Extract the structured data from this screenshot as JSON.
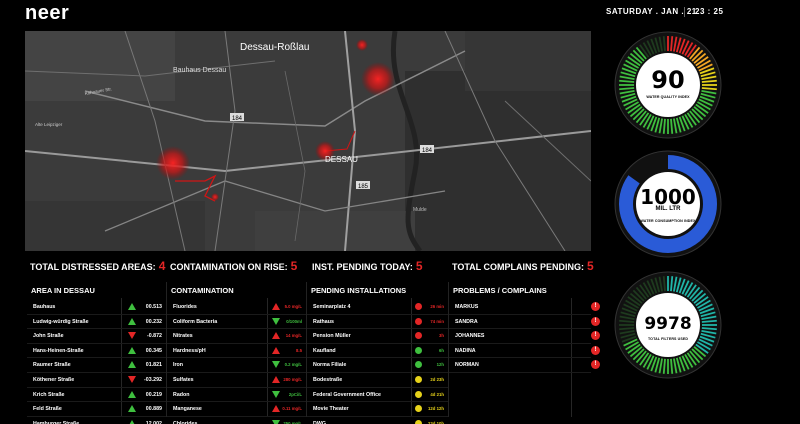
{
  "header": {
    "logo": "neer",
    "date": "SATURDAY . JAN . 21",
    "time": "23 : 25"
  },
  "map": {
    "labels": [
      "Dessau-Roßlau",
      "Bauhaus Dessau",
      "DESSAU",
      "184",
      "185",
      "184",
      "Kühnauer Str.",
      "Alte Leipziger",
      "Mulde"
    ]
  },
  "gauges": [
    {
      "value": "90",
      "unit": "",
      "label": "WATER QUALITY INDEX",
      "level": 0.9
    },
    {
      "value": "1000",
      "unit": "MIL. LTR",
      "label": "WATER CONSUMPTION INDEX",
      "level": 0.85
    },
    {
      "value": "9978",
      "unit": "",
      "label": "TOTAL FILTERS USED",
      "level": 0.7
    }
  ],
  "stats": [
    {
      "label": "TOTAL DISTRESSED AREAS:",
      "value": "4"
    },
    {
      "label": "CONTAMINATION ON RISE:",
      "value": "5"
    },
    {
      "label": "INST. PENDING TODAY:",
      "value": "5"
    },
    {
      "label": "TOTAL COMPLAINS PENDING:",
      "value": "5"
    }
  ],
  "areas": {
    "title": "AREA IN DESSAU",
    "rows": [
      {
        "name": "Bauhaus",
        "trend": "up",
        "value": "00.513"
      },
      {
        "name": "Ludwig-würdig Straße",
        "trend": "up",
        "value": "00.232"
      },
      {
        "name": "John Straße",
        "trend": "down",
        "value": "-0.872"
      },
      {
        "name": "Hans-Heinen-Straße",
        "trend": "up",
        "value": "00.345"
      },
      {
        "name": "Raumer Straße",
        "trend": "up",
        "value": "01.821"
      },
      {
        "name": "Köthener Straße",
        "trend": "down",
        "value": "-03.292"
      },
      {
        "name": "Krich Straße",
        "trend": "up",
        "value": "00.219"
      },
      {
        "name": "Feld Straße",
        "trend": "up",
        "value": "00.889"
      },
      {
        "name": "Hamburger Straße",
        "trend": "up",
        "value": "12.002"
      }
    ]
  },
  "contamination": {
    "title": "CONTAMINATION",
    "rows": [
      {
        "name": "Fluorides",
        "trend": "up-red",
        "value": "5.0 mg/L"
      },
      {
        "name": "Coliform Bacteria",
        "trend": "down-green",
        "value": "0/100ml"
      },
      {
        "name": "Nitrates",
        "trend": "up-red",
        "value": "14 mg/L"
      },
      {
        "name": "Hardness/pH",
        "trend": "up-red",
        "value": "8.5"
      },
      {
        "name": "Iron",
        "trend": "down-green",
        "value": "0.2 mg/L"
      },
      {
        "name": "Sulfates",
        "trend": "up-red",
        "value": "280 mg/L"
      },
      {
        "name": "Radon",
        "trend": "down-green",
        "value": "2pCi/L"
      },
      {
        "name": "Manganese",
        "trend": "up-red",
        "value": "0.11 mg/L"
      },
      {
        "name": "Chlorides",
        "trend": "down-green",
        "value": "250 mg/L"
      }
    ]
  },
  "installations": {
    "title": "PENDING INSTALLATIONS",
    "rows": [
      {
        "name": "Seminarplatz 4",
        "status": "red",
        "value": "26 min"
      },
      {
        "name": "Rathaus",
        "status": "red",
        "value": "74 min"
      },
      {
        "name": "Pension Müller",
        "status": "red",
        "value": "3h"
      },
      {
        "name": "Kaufland",
        "status": "green",
        "value": "6h"
      },
      {
        "name": "Norma Filiale",
        "status": "green",
        "value": "12h"
      },
      {
        "name": "Bodestraße",
        "status": "yellow",
        "value": "2d 23h"
      },
      {
        "name": "Federal Government Office",
        "status": "yellow",
        "value": "4d 21h"
      },
      {
        "name": "Movie Theater",
        "status": "yellow",
        "value": "12d 12h"
      },
      {
        "name": "DWG",
        "status": "yellow",
        "value": "23d 10h"
      }
    ]
  },
  "complaints": {
    "title": "PROBLEMS / COMPLAINS",
    "rows": [
      {
        "name": "MARKUS"
      },
      {
        "name": "SANDRA"
      },
      {
        "name": "JOHANNES"
      },
      {
        "name": "NADINA"
      },
      {
        "name": "NORMAN"
      }
    ]
  },
  "colors": {
    "alert": "#e32626",
    "ok": "#3fbf3f",
    "pending": "#e6d21a",
    "gauge_blue": "#2a5bd7"
  }
}
